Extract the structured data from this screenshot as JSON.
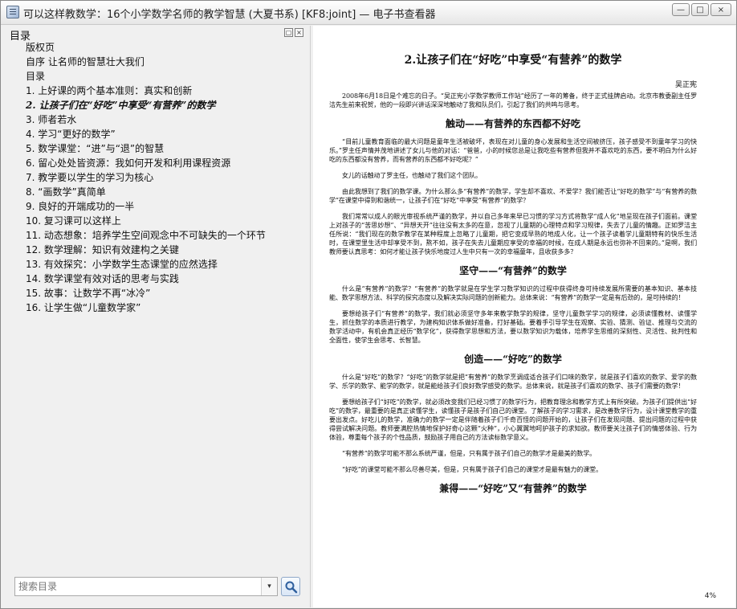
{
  "window": {
    "title": "可以这样教数学：16个小学数学名师的教学智慧 (大夏书系) [KF8:joint] — 电子书查看器",
    "buttons": [
      "—",
      "□",
      "×"
    ]
  },
  "toc": {
    "header": "目录",
    "header_buttons": [
      "▢",
      "×"
    ],
    "items": [
      "版权页",
      "自序 让名师的智慧壮大我们",
      "目录",
      "1. 上好课的两个基本准则：真实和创新",
      "2. 让孩子们在“好吃”中享受“有营养”的数学",
      "3. 师者若水",
      "4. 学习“更好的数学”",
      "5. 数学课堂：“进”与“退”的智慧",
      "6. 留心处处皆资源：我如何开发和利用课程资源",
      "7. 教学要以学生的学习为核心",
      "8. “画数学”真简单",
      "9. 良好的开端成功的一半",
      "10. 复习课可以这样上",
      "11. 动态想象：培养学生空间观念中不可缺失的一个环节",
      "12. 数学理解：知识有效建构之关键",
      "13. 有效探究：小学数学生态课堂的应然选择",
      "14. 数学课堂有效对话的思考与实践",
      "15. 故事：让数学不再“冰冷”",
      "16. 让学生做“儿童数学家”"
    ],
    "active_index": 4,
    "search_placeholder": "搜索目录",
    "dropdown_icon": "▾"
  },
  "reader": {
    "zoom_text": "4%",
    "chapter_title": "2.让孩子们在“好吃”中享受“有营养”的数学",
    "author": "吴正宪",
    "blocks": [
      {
        "type": "p",
        "text": "2008年6月18日是个难忘的日子。“吴正宪小学数学教师工作站”经历了一年的筹备，终于正式挂牌启动。北京市教委副主任罗洁先生前来祝贺，他的一段即兴讲话深深地触动了我和队员们，引起了我们的共鸣与思考。"
      },
      {
        "type": "h",
        "text": "触动——有营养的东西都不好吃"
      },
      {
        "type": "p",
        "text": "“目前儿童教育面临的最大问题是童年生活被破坏，表现在对儿童的身心发展和生活空间被挤压，孩子感受不到童年学习的快乐。”罗主任声情并茂地讲述了女儿与他的对话：“爸爸，小的时候您总是让我吃些有营养但我并不喜欢吃的东西，要不明白为什么好吃的东西都没有营养，而有营养的东西都不好吃呢？”"
      },
      {
        "type": "p",
        "text": "女儿的话触动了罗主任，也触动了我们这个团队。"
      },
      {
        "type": "p",
        "text": "由此我想到了我们的数学课。为什么那么多“有营养”的数学，学生却不喜欢、不爱学？我们能否让“好吃的数学”与“有营养的数学”在课堂中得到和谐统一，让孩子们在“好吃”中享受“有营养”的数学？"
      },
      {
        "type": "p",
        "text": "我们常常以成人的眼光审视系统严谨的数学，并以自己多年来早已习惯的学习方式将数学“成人化”地呈现在孩子们面前。课堂上对孩子的“苦思妙想”、“异想天开”往往没有太多的在意，忽视了儿童期的心理特点和学习规律，失去了儿童的情趣。正如罗洁主任所说：“我们现在的数学教学在某种程度上忽略了儿童期，把它变成早熟的地成人化，让一个孩子读着学儿童期特有的快乐生活时，在课堂里生活中却享受不到，熬不如，孩子在失去儿童期应享受的幸福的时候，在成人期是永远也弥补不回来的。”是啊，我们教师要认真思考：如何才能让孩子快乐地度过人生中只有一次的幸福童年，且收获多多？"
      },
      {
        "type": "h",
        "text": "坚守——“有营养”的数学"
      },
      {
        "type": "p",
        "text": "什么是“有营养”的数学？“有营养”的数学就是在学生学习数学知识的过程中获得终身可持续发展所需要的基本知识、基本技能、数学思想方法、科学的探究态度以及解决实际问题的创新能力。总体来说：“有营养”的数学一定是有后劲的，是可持续的！"
      },
      {
        "type": "p",
        "text": "要想给孩子们“有营养”的数学，我们就必须坚守多年来教学数学的规律，坚守儿童数学学习的规律，必须读懂教材、读懂学生，抓住数学的本质进行教学，为建构知识体系做好准备，打好基础。要着手引导学生在观察、实验、猜测、验证、推理与交流的数学活动中，有机会真正经历“数学化”，获得数学思想和方法，要以数学知识为载体，培养学生思维的深刻性、灵活性、批判性和全面性，使学生会思考、长智慧。"
      },
      {
        "type": "h",
        "text": "创造——“好吃”的数学"
      },
      {
        "type": "p",
        "text": "什么是“好吃”的数学？“好吃”的数学就是把“有营养”的数学烹调成适合孩子们口味的数学，就是孩子们喜欢的数学、爱学的数学、乐学的数学、能学的数学，就是能给孩子们良好数学感受的数学。总体来说，就是孩子们喜欢的数学、孩子们需要的数学！"
      },
      {
        "type": "p",
        "text": "要想给孩子们“好吃”的数学，就必须改变我们已经习惯了的数学行为，把教育理念和教学方式上有所突破。为孩子们提供出“好吃”的数学，最重要的是真正读懂学生，读懂孩子是孩子们自己的课堂。了解孩子的学习需求，是改善数学行为，设计课堂教学的重要出发点。好吃儿的数学，准确力的数学一定是伴随着孩子们千奇百怪的问题开始的，让孩子们在发现问题、提出问题的过程中获得尝试解决问题。教师要满腔热情地保护好奇心这颗“火种”，小心翼翼地呵护孩子的求知欲。教师要关注孩子们的情感体验、行为体验，尊重每个孩子的个性品质，鼓励孩子用自己的方法读标数学意义。"
      },
      {
        "type": "p",
        "text": "“有营养”的数学可能不那么系统严谨，但是，只有属于孩子们自己的数学才是最美的数学。"
      },
      {
        "type": "p",
        "text": "“好吃”的课堂可能不那么尽善尽美，但是，只有属于孩子们自己的课堂才是最有魅力的课堂。"
      },
      {
        "type": "h",
        "text": "兼得——“好吃”又“有营养”的数学"
      }
    ]
  }
}
